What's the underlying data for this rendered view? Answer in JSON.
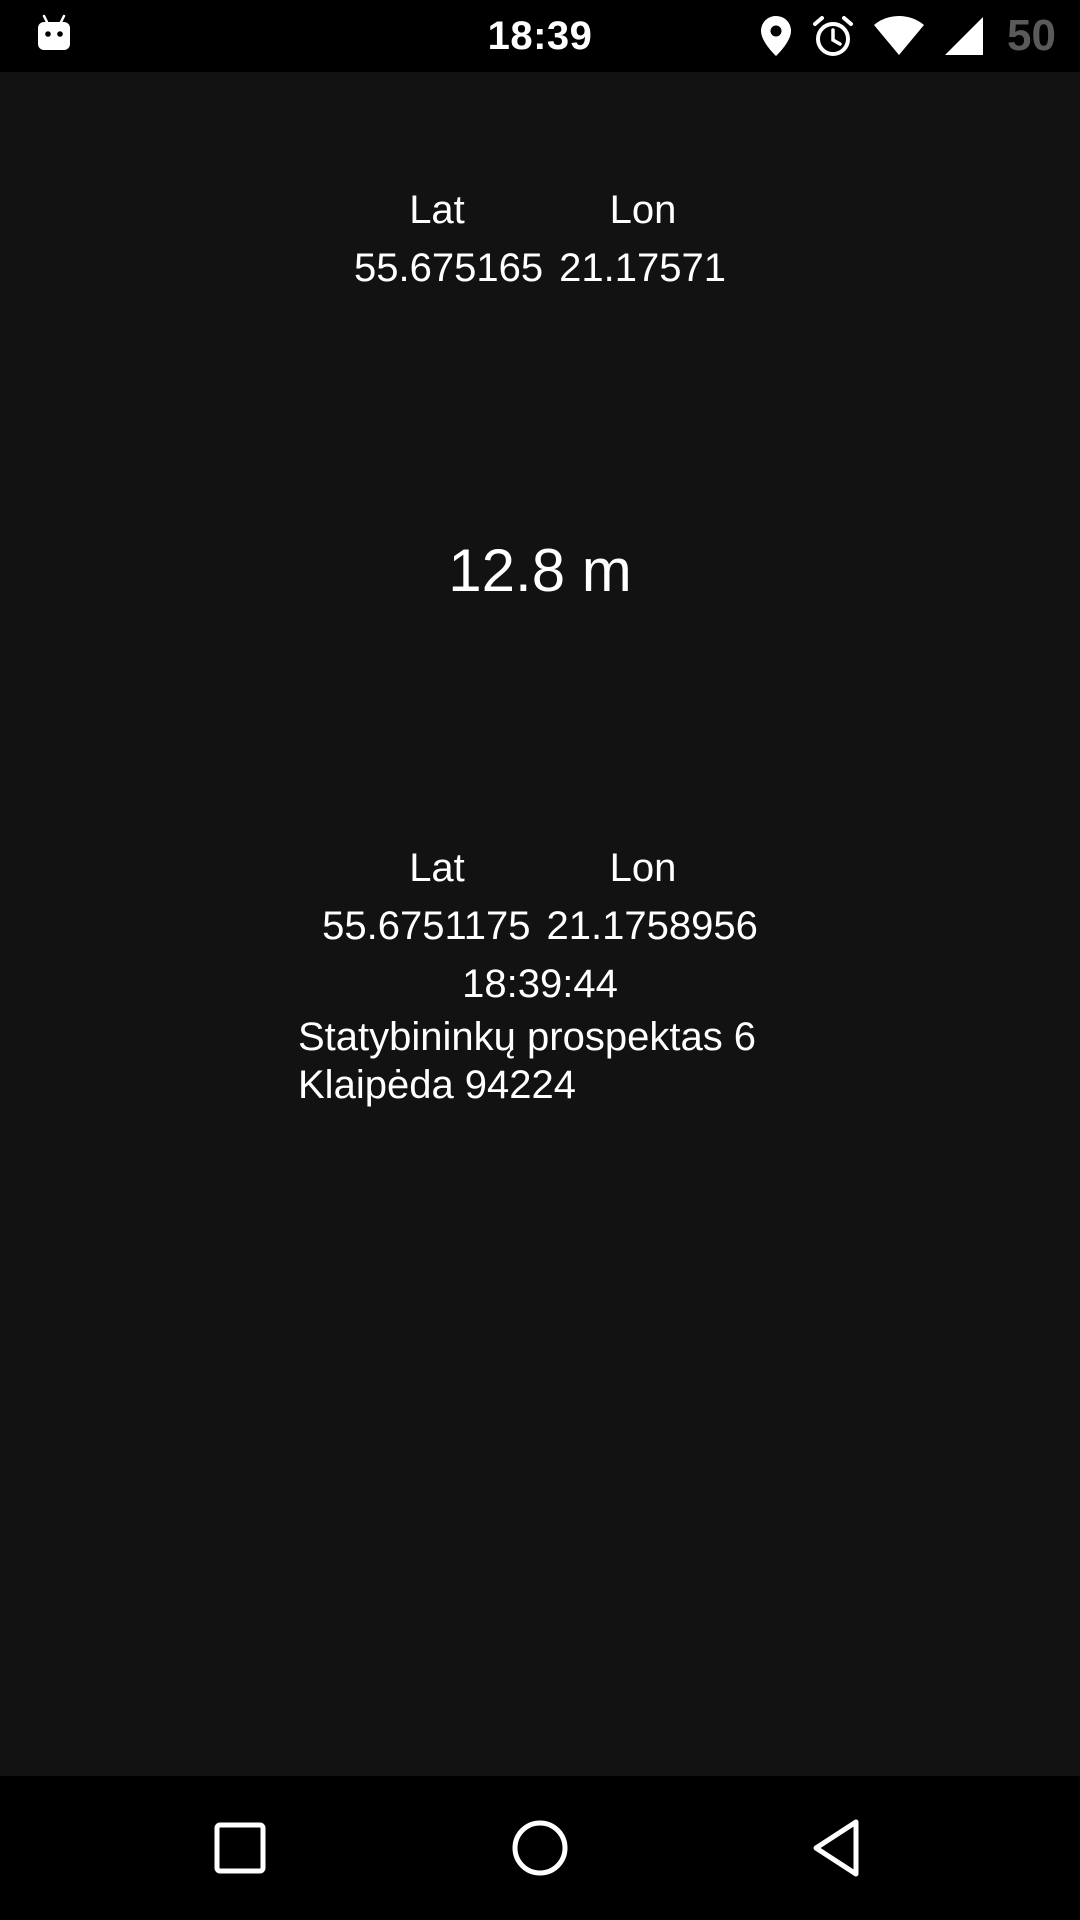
{
  "status_bar": {
    "time": "18:39",
    "battery_level": "50",
    "icons": [
      "android-icon",
      "location-pin-icon",
      "alarm-icon",
      "wifi-icon",
      "cell-signal-icon"
    ]
  },
  "current_fix": {
    "lat_label": "Lat",
    "lon_label": "Lon",
    "lat_value": "55.675165",
    "lon_value": "21.17571"
  },
  "distance": "12.8 m",
  "reference_fix": {
    "lat_label": "Lat",
    "lon_label": "Lon",
    "lat_value": "55.6751175",
    "lon_value": "21.1758956",
    "time": "18:39:44",
    "address_line1": "Statybininkų prospektas 6",
    "address_line2": "Klaipėda 94224"
  },
  "nav_bar": {
    "buttons": [
      "recents-icon",
      "home-icon",
      "back-icon"
    ]
  },
  "colors": {
    "background": "#121212",
    "bars": "#000000",
    "text": "#ffffff",
    "battery_text": "#5a5a5a"
  }
}
